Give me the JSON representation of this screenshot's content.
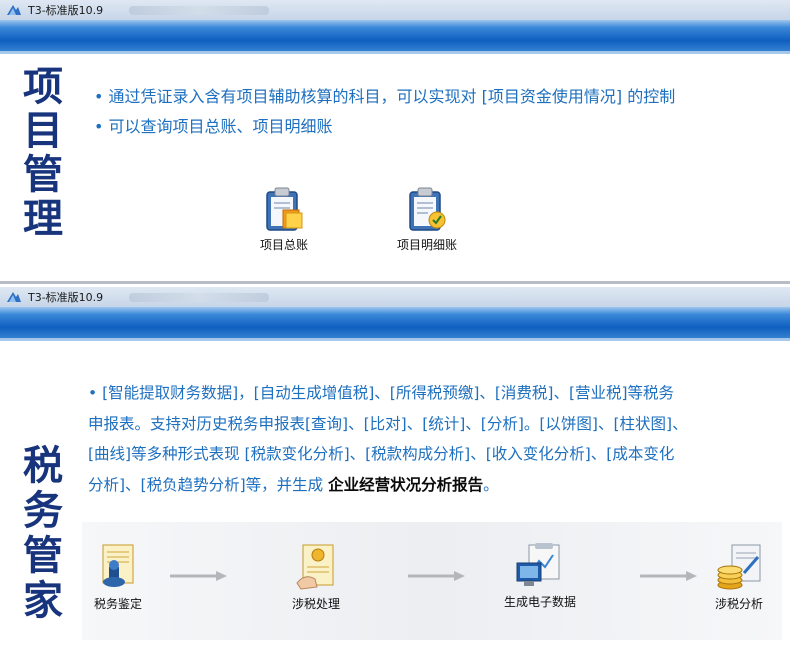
{
  "window": {
    "app_title": "T3-标准版10.9"
  },
  "project": {
    "title_chars": [
      "项",
      "目",
      "管",
      "理"
    ],
    "bullets": [
      "通过凭证录入含有项目辅助核算的科目，可以实现对 [项目资金使用情况] 的控制",
      "可以查询项目总账、项目明细账"
    ],
    "icons": [
      {
        "label": "项目总账",
        "icon": "clipboard-ledger-icon"
      },
      {
        "label": "项目明细账",
        "icon": "clipboard-detail-icon"
      }
    ]
  },
  "tax": {
    "title_chars": [
      "税",
      "务",
      "管",
      "家"
    ],
    "desc_lines": [
      "[智能提取财务数据]，[自动生成增值税]、[所得税预缴]、[消费税]、[营业税]等税务",
      "申报表。支持对历史税务申报表[查询]、[比对]、[统计]、[分析]。[以饼图]、[柱状图]、",
      "[曲线]等多种形式表现 [税款变化分析]、[税款构成分析]、[收入变化分析]、[成本变化",
      "分析]、[税负趋势分析]等，并生成 "
    ],
    "desc_strong": "企业经营状况分析报告",
    "desc_end": "。",
    "flow": [
      {
        "label": "税务鉴定",
        "icon": "tax-stamp-icon"
      },
      {
        "label": "涉税处理",
        "icon": "tax-processing-icon"
      },
      {
        "label": "生成电子数据",
        "icon": "monitor-data-icon"
      },
      {
        "label": "涉税分析",
        "icon": "coins-analysis-icon"
      }
    ]
  },
  "colors": {
    "accent_blue": "#1d6fbf",
    "title_navy": "#17347c",
    "bar_blue": "#0e5fc0"
  }
}
